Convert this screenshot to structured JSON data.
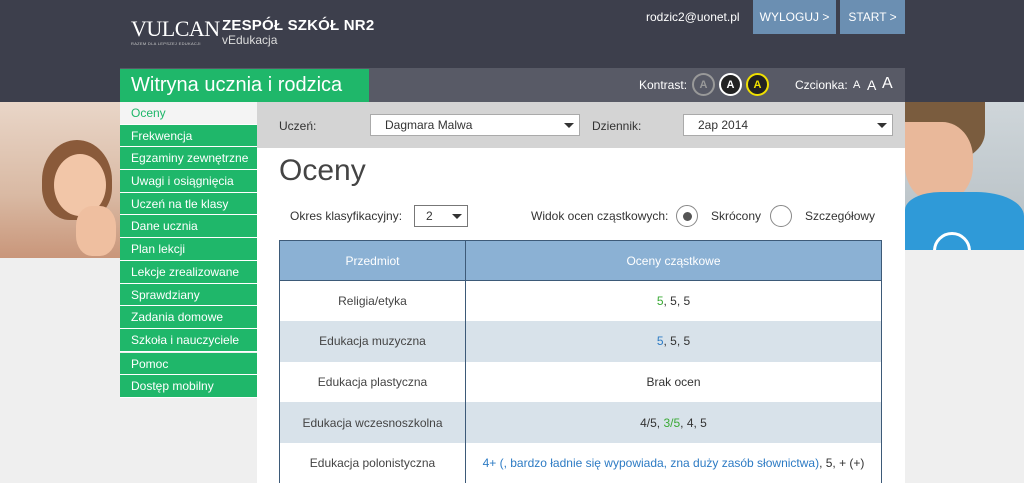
{
  "header": {
    "logo_text": "VULCAN",
    "logo_tagline": "RAZEM DLA LEPSZEJ EDUKACJI",
    "school_name": "ZESPÓŁ SZKÓŁ NR2",
    "school_sub": "vEdukacja",
    "user_email": "rodzic2@uonet.pl",
    "logout_label": "WYLOGUJ >",
    "start_label": "START >"
  },
  "nav": {
    "site_title": "Witryna ucznia i rodzica",
    "contrast_label": "Kontrast:",
    "contrast_options": [
      "A",
      "A",
      "A"
    ],
    "font_label": "Czcionka:",
    "font_sizes": [
      "A",
      "A",
      "A"
    ]
  },
  "sidebar": {
    "items": [
      {
        "label": "Oceny"
      },
      {
        "label": "Frekwencja"
      },
      {
        "label": "Egzaminy zewnętrzne"
      },
      {
        "label": "Uwagi i osiągnięcia"
      },
      {
        "label": "Uczeń na tle klasy"
      },
      {
        "label": "Dane ucznia"
      },
      {
        "label": "Plan lekcji"
      },
      {
        "label": "Lekcje zrealizowane"
      },
      {
        "label": "Sprawdziany"
      },
      {
        "label": "Zadania domowe"
      },
      {
        "label": "Szkoła i nauczyciele"
      },
      {
        "label": "Pomoc"
      },
      {
        "label": "Dostęp mobilny"
      }
    ]
  },
  "filters": {
    "student_label": "Uczeń:",
    "student_value": "Dagmara Malwa",
    "journal_label": "Dziennik:",
    "journal_value": "2ap 2014"
  },
  "main": {
    "title": "Oceny",
    "period_label": "Okres klasyfikacyjny:",
    "period_value": "2",
    "view_label": "Widok ocen cząstkowych:",
    "view_short": "Skrócony",
    "view_detailed": "Szczegółowy"
  },
  "table": {
    "headers": [
      "Przedmiot",
      "Oceny cząstkowe"
    ],
    "rows": [
      {
        "subject": "Religia/etyka",
        "g1": "5",
        "g2": ", 5, 5",
        "g3": "",
        "g4": ""
      },
      {
        "subject": "Edukacja muzyczna",
        "g1": "5",
        "g2": ", 5, 5",
        "g3": "",
        "g4": ""
      },
      {
        "subject": "Edukacja plastyczna",
        "g1": "",
        "g2": "Brak ocen",
        "g3": "",
        "g4": ""
      },
      {
        "subject": "Edukacja wczesnoszkolna",
        "g1": "4/5, ",
        "g2": "3/5",
        "g3": ", 4, 5",
        "g4": ""
      },
      {
        "subject": "Edukacja polonistyczna",
        "g1": "4+ (, bardzo ładnie się wypowiada, zna duży zasób słownictwa)",
        "g2": ", 5, + (+)",
        "g3": "",
        "g4": ""
      }
    ]
  },
  "colors": {
    "green": "#1fb76a",
    "header_dark": "#3d3f4c",
    "button_blue": "#6b8fb2",
    "table_header": "#8bb1d4"
  }
}
